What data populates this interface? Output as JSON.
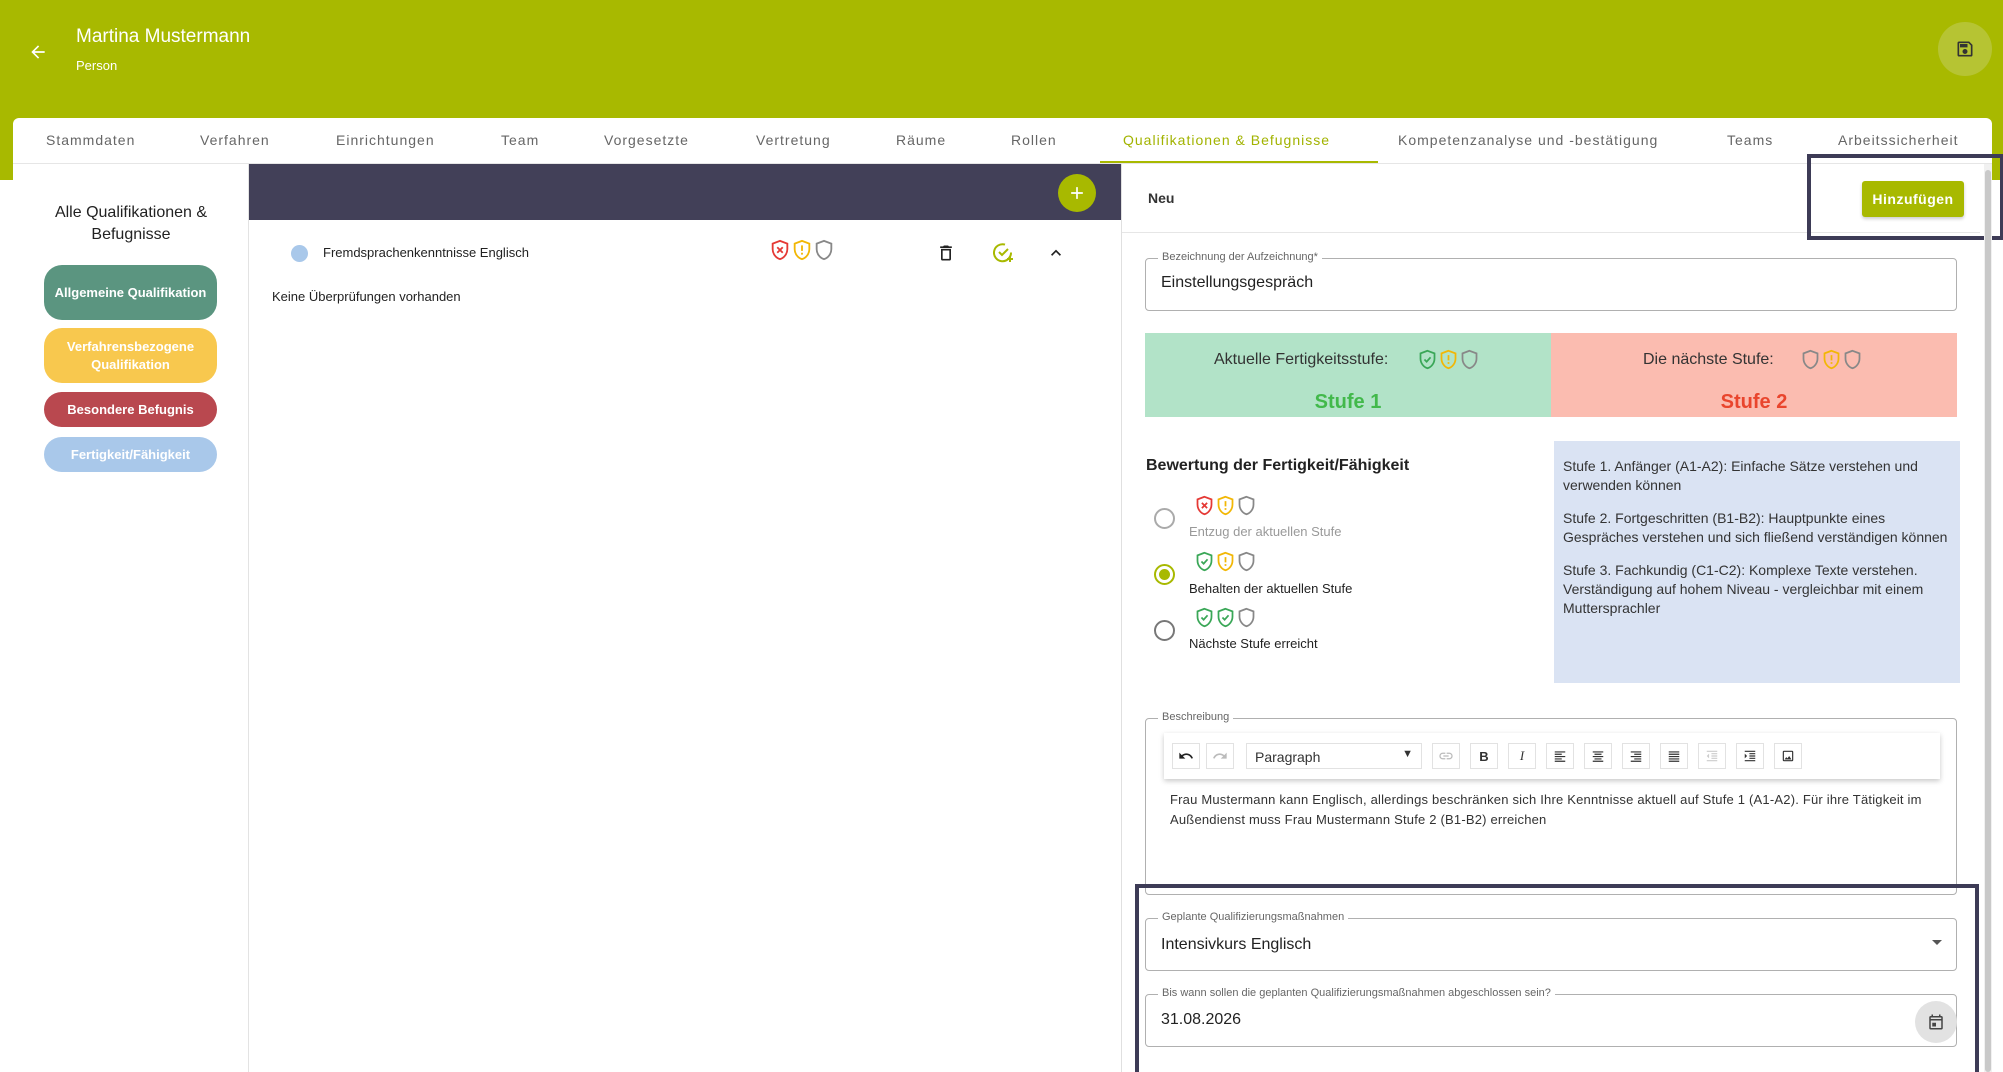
{
  "header": {
    "title": "Martina Mustermann",
    "subtitle": "Person"
  },
  "tabs": [
    {
      "label": "Stammdaten"
    },
    {
      "label": "Verfahren"
    },
    {
      "label": "Einrichtungen"
    },
    {
      "label": "Team"
    },
    {
      "label": "Vorgesetzte"
    },
    {
      "label": "Vertretung"
    },
    {
      "label": "Räume"
    },
    {
      "label": "Rollen"
    },
    {
      "label": "Qualifikationen & Befugnisse",
      "active": true
    },
    {
      "label": "Kompetenzanalyse und -bestätigung"
    },
    {
      "label": "Teams"
    },
    {
      "label": "Arbeitssicherheit"
    }
  ],
  "sidebar": {
    "title": "Alle Qualifikationen & Befugnisse",
    "filters": [
      {
        "label": "Allgemeine Qualifikation",
        "color": "#5b9580"
      },
      {
        "label": "Verfahrensbezogene Qualifikation",
        "color": "#f8c84e"
      },
      {
        "label": "Besondere Befugnis",
        "color": "#b9484f"
      },
      {
        "label": "Fertigkeit/Fähigkeit",
        "color": "#a9c8ea"
      }
    ]
  },
  "list": {
    "item": {
      "name": "Fremdsprachenkenntnisse Englisch",
      "dot_color": "#a9c8ea",
      "shields": [
        "x-red",
        "warn-yellow",
        "empty-grey"
      ]
    },
    "no_reviews": "Keine Überprüfungen vorhanden"
  },
  "form": {
    "new_label": "Neu",
    "add_button": "Hinzufügen",
    "record_name": {
      "label": "Bezeichnung der Aufzeichnung*",
      "value": "Einstellungsgespräch"
    },
    "current_level": {
      "label": "Aktuelle Fertigkeitsstufe:",
      "value": "Stufe 1",
      "shields": [
        "check-green",
        "warn-yellow",
        "empty-grey"
      ]
    },
    "next_level": {
      "label": "Die nächste Stufe:",
      "value": "Stufe 2",
      "shields": [
        "empty-grey",
        "warn-yellow",
        "empty-grey"
      ]
    },
    "evaluation": {
      "title": "Bewertung der Fertigkeit/Fähigkeit",
      "options": [
        {
          "label": "Entzug der aktuellen Stufe",
          "selected": false,
          "disabled": true,
          "shields": [
            "x-red",
            "warn-yellow",
            "empty-grey"
          ]
        },
        {
          "label": "Behalten der aktuellen Stufe",
          "selected": true,
          "disabled": false,
          "shields": [
            "check-green",
            "warn-yellow",
            "empty-grey"
          ]
        },
        {
          "label": "Nächste Stufe erreicht",
          "selected": false,
          "disabled": false,
          "shields": [
            "check-green",
            "check-green",
            "empty-grey"
          ]
        }
      ]
    },
    "level_info": [
      "Stufe 1. Anfänger (A1-A2): Einfache Sätze verstehen und verwenden können",
      "Stufe 2. Fortgeschritten (B1-B2): Hauptpunkte eines Gespräches verstehen und sich fließend verständigen können",
      "Stufe 3. Fachkundig (C1-C2): Komplexe Texte verstehen. Verständigung auf hohem Niveau - vergleichbar mit einem Muttersprachler"
    ],
    "description": {
      "label": "Beschreibung",
      "block_format": "Paragraph",
      "text": "Frau Mustermann kann Englisch, allerdings beschränken sich Ihre Kenntnisse aktuell auf Stufe 1 (A1-A2). Für ihre Tätigkeit im Außendienst muss Frau Mustermann Stufe 2 (B1-B2) erreichen"
    },
    "planned_measures": {
      "label": "Geplante Qualifizierungsmaßnahmen",
      "value": "Intensivkurs Englisch"
    },
    "deadline": {
      "label": "Bis wann sollen die geplanten Qualifizierungsmaßnahmen abgeschlossen sein?",
      "value": "31.08.2026"
    }
  },
  "colors": {
    "accent": "#a8b900",
    "dark_bar": "#424058",
    "level_current_bg": "#b2e3c8",
    "level_current_text": "#42b94b",
    "level_next_bg": "#fbbcb0",
    "level_next_text": "#e9452d",
    "info_bg": "#dae3f3"
  }
}
